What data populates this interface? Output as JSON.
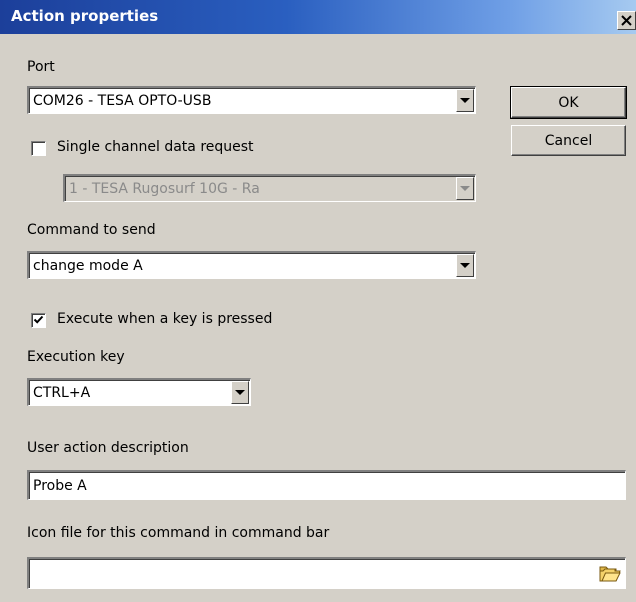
{
  "window": {
    "title": "Action properties",
    "close_glyph": "✕"
  },
  "port": {
    "label": "Port",
    "value": "COM26 - TESA OPTO-USB"
  },
  "buttons": {
    "ok": "OK",
    "cancel": "Cancel"
  },
  "single_channel": {
    "label": "Single channel data request",
    "checked": false,
    "channel_value": "1 - TESA Rugosurf 10G - Ra"
  },
  "command": {
    "label": "Command to send",
    "value": "change mode A"
  },
  "execute_on_key": {
    "label": "Execute when a key is pressed",
    "checked": true
  },
  "execution_key": {
    "label": "Execution key",
    "value": "CTRL+A"
  },
  "description": {
    "label": "User action description",
    "value": "Probe A"
  },
  "icon_file": {
    "label": "Icon file for this command in command bar",
    "value": "",
    "browse_icon": "folder-open-icon"
  }
}
